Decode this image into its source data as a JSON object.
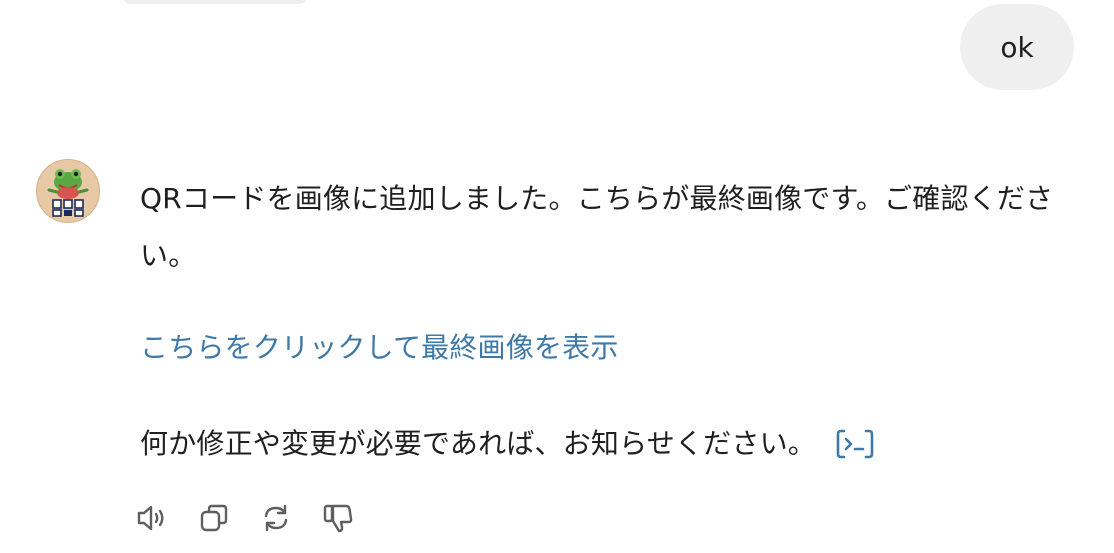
{
  "conversation": {
    "user_message": "ok",
    "assistant": {
      "avatar_icon": "frog-qr-avatar-icon",
      "message": "QRコードを画像に追加しました。こちらが最終画像です。ご確認ください。",
      "link_text": "こちらをクリックして最終画像を表示",
      "followup": "何か修正や変更が必要であれば、お知らせください。",
      "code_icon": "code-interpreter-icon"
    },
    "actions": [
      {
        "icon": "speaker-icon"
      },
      {
        "icon": "copy-icon"
      },
      {
        "icon": "regenerate-icon"
      },
      {
        "icon": "thumbs-down-icon"
      }
    ]
  },
  "colors": {
    "link": "#3e79a8",
    "user_bubble": "#efefef",
    "text": "#1f1f1f",
    "icon": "#5f5f5f"
  }
}
